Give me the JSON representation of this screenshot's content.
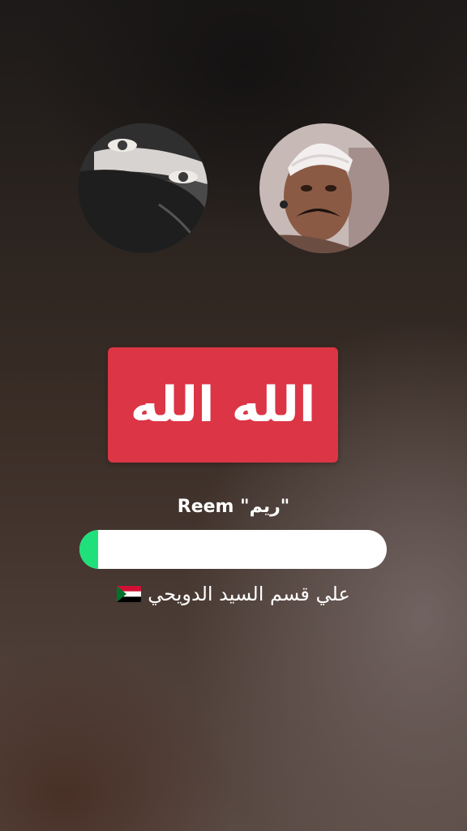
{
  "title": "الله الله",
  "subtitle_name": "\"ريم\" Reem",
  "progress": 0.06,
  "artist": "علي قسم السيد الدويحي",
  "flag_icon": "sudan-flag-icon",
  "colors": {
    "title_bg": "#dc3545",
    "progress_fill": "#1fe07a",
    "progress_track": "#ffffff"
  }
}
